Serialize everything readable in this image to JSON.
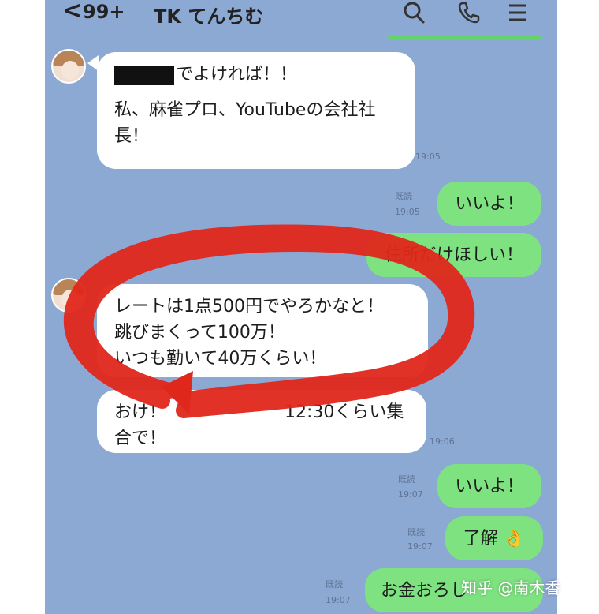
{
  "header": {
    "back_glyph": "<",
    "unread_count": "99+",
    "chat_title": "TK てんちむ",
    "icons": [
      "search-icon",
      "phone-icon",
      "menu-icon"
    ]
  },
  "messages": [
    {
      "side": "in",
      "line1_suffix": "でよければ！！",
      "line2": "私、麻雀プロ、YouTubeの会社社",
      "line3": "長！",
      "time": "19:05"
    },
    {
      "side": "out",
      "text": "いいよ！",
      "read": "既読",
      "time": "19:05"
    },
    {
      "side": "out",
      "text": "住所だけほしい！"
    },
    {
      "side": "in",
      "line1": "レートは1点500円でやろかなと！",
      "line2": "跳びまくって100万！",
      "line3": "いつも勤いて40万くらい！"
    },
    {
      "side": "in",
      "line1_prefix": "おけ！",
      "line1_suffix": "12:30くらい集",
      "line2": "合で！",
      "time": "19:06"
    },
    {
      "side": "out",
      "text": "いいよ！",
      "read": "既読",
      "time": "19:07"
    },
    {
      "side": "out",
      "text": "了解",
      "emoji": "👌",
      "read": "既読",
      "time": "19:07"
    },
    {
      "side": "out",
      "text": "お金おろし",
      "read": "既読",
      "time": "19:07"
    }
  ],
  "watermark": {
    "text": "知乎 @南木香"
  },
  "colors": {
    "chat_bg": "#8ca9d3",
    "outgoing": "#7ee281",
    "incoming": "#ffffff",
    "annotation": "#e0271b"
  }
}
